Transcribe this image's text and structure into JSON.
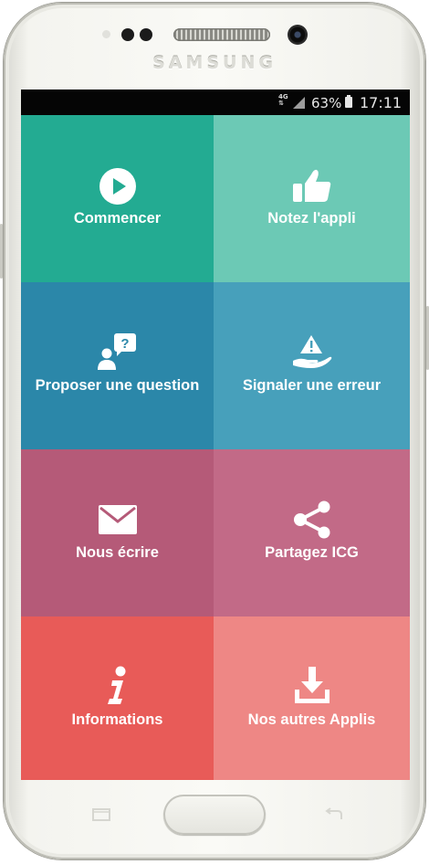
{
  "device": {
    "brand": "SAMSUNG"
  },
  "status_bar": {
    "network": "4G",
    "battery": "63%",
    "time": "17:11"
  },
  "tiles": [
    {
      "label": "Commencer",
      "color": "#23ab92",
      "icon": "play-icon"
    },
    {
      "label": "Notez l'appli",
      "color": "#6cc9b5",
      "icon": "thumbs-up-icon"
    },
    {
      "label": "Proposer une question",
      "color": "#2b87a9",
      "icon": "user-question-icon"
    },
    {
      "label": "Signaler une erreur",
      "color": "#47a0bb",
      "icon": "warning-hand-icon"
    },
    {
      "label": "Nous écrire",
      "color": "#b55a78",
      "icon": "envelope-icon"
    },
    {
      "label": "Partagez ICG",
      "color": "#c26a87",
      "icon": "share-icon"
    },
    {
      "label": "Informations",
      "color": "#e85b58",
      "icon": "info-icon"
    },
    {
      "label": "Nos autres Applis",
      "color": "#ee8785",
      "icon": "download-icon"
    }
  ]
}
